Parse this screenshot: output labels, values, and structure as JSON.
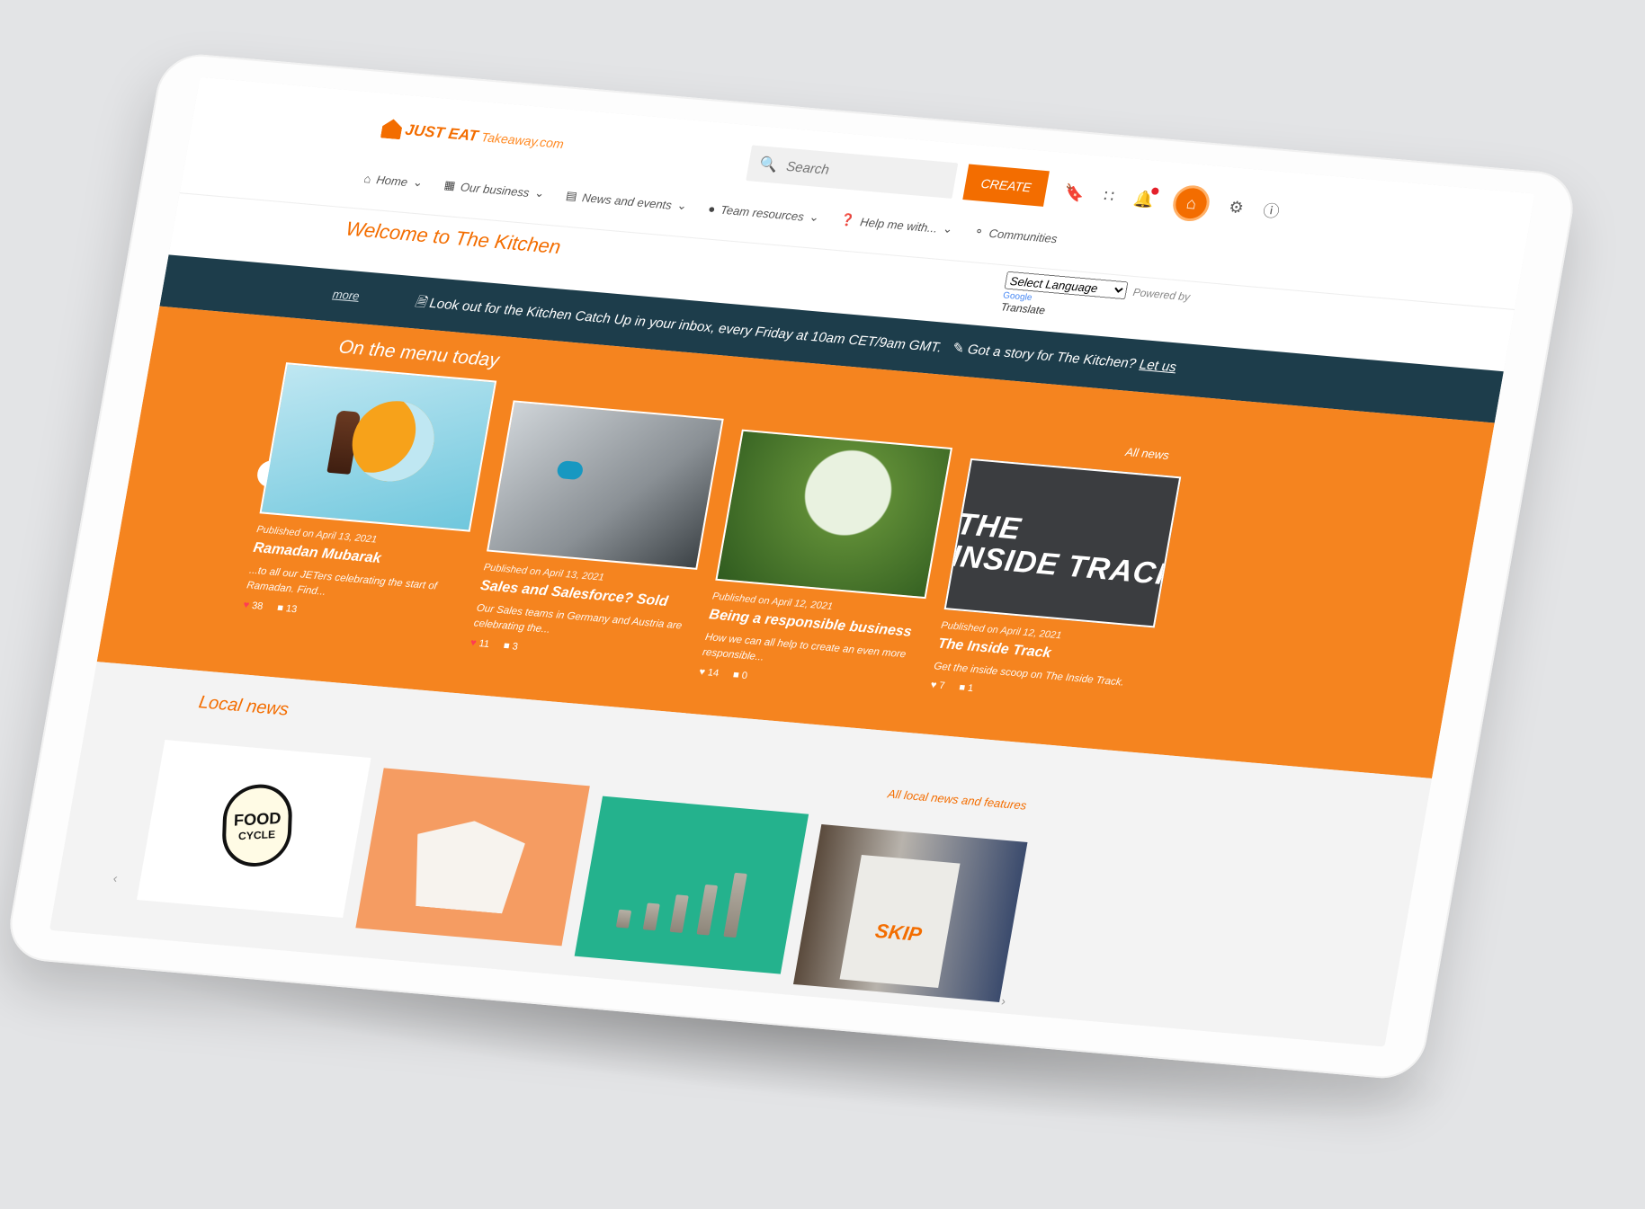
{
  "header": {
    "logo_text": "JUST EAT",
    "logo_sub": "Takeaway.com",
    "search_placeholder": "Search",
    "create_label": "CREATE"
  },
  "nav": {
    "items": [
      {
        "label": "Home",
        "icon": "home-icon"
      },
      {
        "label": "Our business",
        "icon": "building-icon"
      },
      {
        "label": "News and events",
        "icon": "newspaper-icon"
      },
      {
        "label": "Team resources",
        "icon": "team-icon"
      },
      {
        "label": "Help me with...",
        "icon": "help-icon"
      },
      {
        "label": "Communities",
        "icon": "communities-icon"
      }
    ]
  },
  "subheader": {
    "welcome": "Welcome to The Kitchen",
    "language_select": "Select Language",
    "powered_by": "Powered by",
    "google": "Google",
    "translate": "Translate"
  },
  "ticker": {
    "more": "more",
    "message1": "Look out for the Kitchen Catch Up in your inbox, every Friday at 10am CET/9am GMT.",
    "message2": "Got a story for The Kitchen?",
    "message2_link": "Let us"
  },
  "menu": {
    "title": "On the menu today",
    "all_news": "All news",
    "cards": [
      {
        "published": "Published on April 13, 2021",
        "title": "Ramadan Mubarak",
        "desc": "...to all our JETers celebrating the start of Ramadan. Find...",
        "likes": "38",
        "comments": "13"
      },
      {
        "published": "Published on April 13, 2021",
        "title": "Sales and Salesforce? Sold",
        "desc": "Our Sales teams in Germany and Austria are celebrating the...",
        "likes": "11",
        "comments": "3"
      },
      {
        "published": "Published on April 12, 2021",
        "title": "Being a responsible business",
        "desc": "How we can all help to create an even more responsible...",
        "likes": "14",
        "comments": "0"
      },
      {
        "published": "Published on April 12, 2021",
        "title": "The Inside Track",
        "desc": "Get the inside scoop on The Inside Track.",
        "likes": "7",
        "comments": "1"
      }
    ],
    "inside_track_image_text": "THE\nINSIDE TRACK"
  },
  "local": {
    "title": "Local news",
    "all_local": "All local news and features",
    "food_cycle_line1": "FOOD",
    "food_cycle_line2": "CYCLE",
    "skip_text": "SKIP"
  },
  "colors": {
    "brand_orange": "#f36d00",
    "menu_orange": "#f5841f",
    "ticker_navy": "#1d3d4b"
  }
}
